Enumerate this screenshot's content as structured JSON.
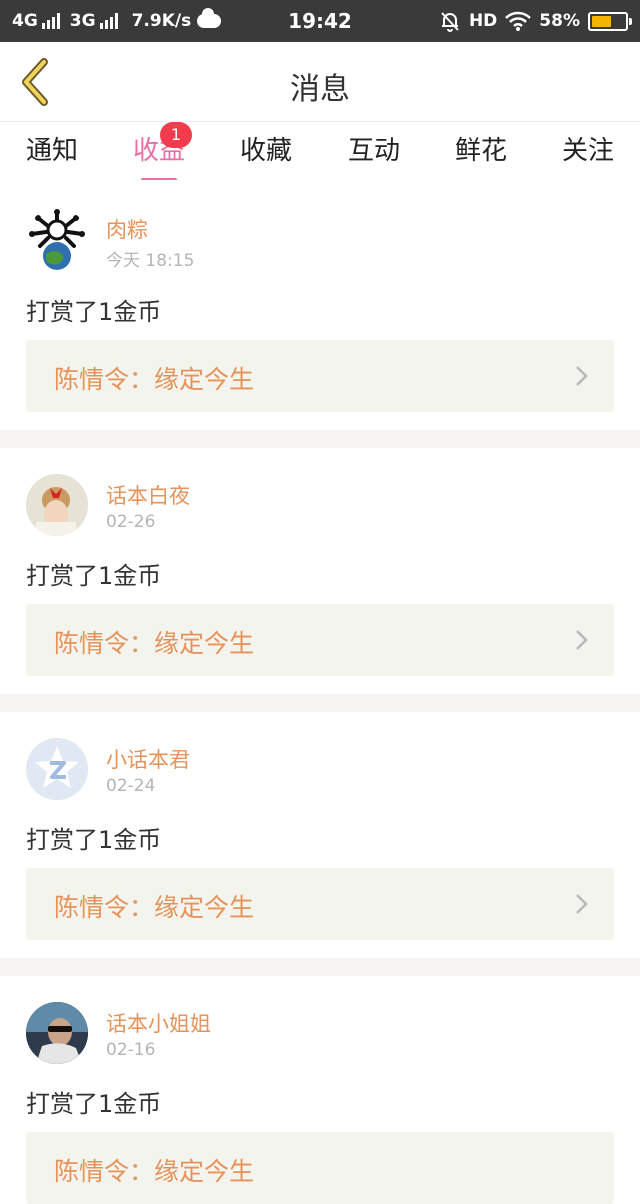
{
  "status_bar": {
    "net1": "4G",
    "net2": "3G",
    "speed": "7.9K/s",
    "time": "19:42",
    "hd": "HD",
    "battery": "58%",
    "battery_level": 0.58
  },
  "header": {
    "title": "消息"
  },
  "tabs": [
    {
      "label": "通知"
    },
    {
      "label": "收益",
      "badge": "1"
    },
    {
      "label": "收藏"
    },
    {
      "label": "互动"
    },
    {
      "label": "鲜花"
    },
    {
      "label": "关注"
    }
  ],
  "messages": [
    {
      "name": "肉粽",
      "date": "今天 18:15",
      "text": "打赏了1金币",
      "link": "陈情令：缘定今生"
    },
    {
      "name": "话本白夜",
      "date": "02-26",
      "text": "打赏了1金币",
      "link": "陈情令：缘定今生"
    },
    {
      "name": "小话本君",
      "date": "02-24",
      "text": "打赏了1金币",
      "link": "陈情令：缘定今生"
    },
    {
      "name": "话本小姐姐",
      "date": "02-16",
      "text": "打赏了1金币",
      "link": "陈情令：缘定今生"
    }
  ],
  "colors": {
    "accent": "#e76fa6",
    "username": "#e6935a",
    "badge": "#f03c4c"
  },
  "icons": [
    "back-icon",
    "cloud-icon",
    "wifi-icon",
    "mute-bell-icon",
    "chevron-right-icon"
  ]
}
